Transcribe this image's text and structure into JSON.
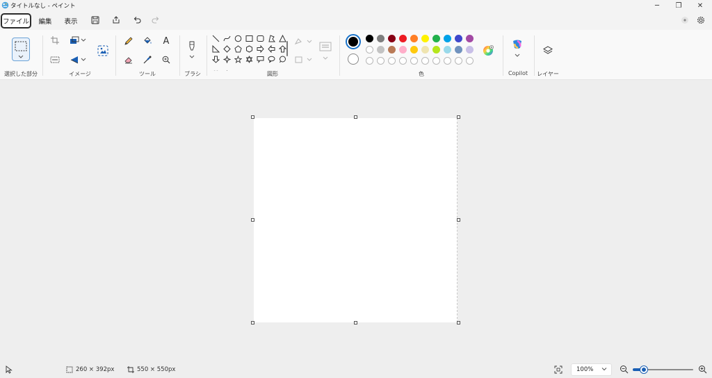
{
  "window": {
    "title": "タイトルなし - ペイント",
    "minimize_glyph": "─",
    "restore_glyph": "❐",
    "close_glyph": "✕"
  },
  "menu": {
    "file": "ファイル",
    "edit": "編集",
    "view": "表示"
  },
  "ribbon": {
    "groups": {
      "selection": "選択した部分",
      "image": "イメージ",
      "tools": "ツール",
      "brushes": "ブラシ",
      "shapes": "図形",
      "colors": "色",
      "copilot": "Copilot",
      "layers": "レイヤー"
    },
    "tools_text_glyph": "A"
  },
  "colors": {
    "primary": "#000000",
    "secondary": "#ffffff",
    "palette_row1": [
      "#000000",
      "#7f7f7f",
      "#880015",
      "#ed1c24",
      "#ff7f27",
      "#fff200",
      "#22b14c",
      "#00a2e8",
      "#3f48cc",
      "#a349a4"
    ],
    "palette_row2": [
      "#ffffff",
      "#c3c3c3",
      "#b97a57",
      "#ffaec9",
      "#ffc90e",
      "#efe4b0",
      "#b5e61d",
      "#99d9ea",
      "#7092be",
      "#c8bfe7"
    ],
    "accent": "#1a5fb4"
  },
  "status": {
    "selection_size": "260 × 392px",
    "canvas_size": "550 × 550px",
    "zoom": "100%"
  }
}
